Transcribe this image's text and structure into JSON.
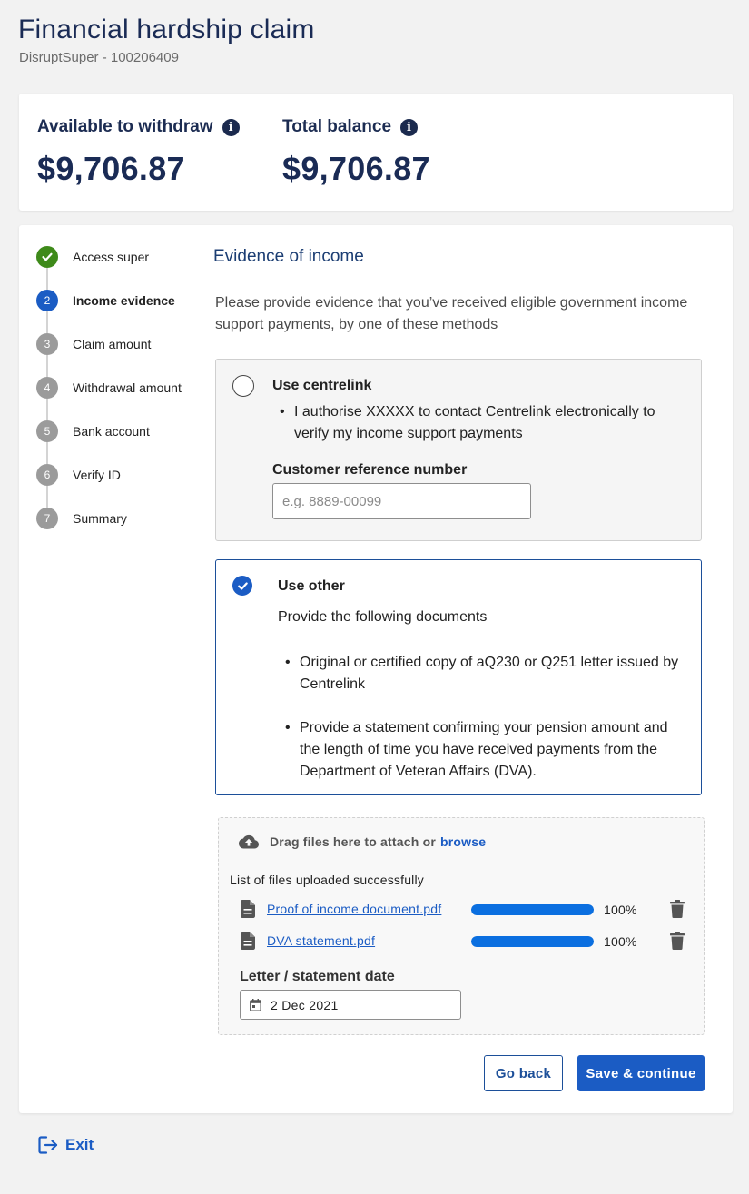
{
  "header": {
    "title": "Financial hardship claim",
    "subtitle": "DisruptSuper - 100206409"
  },
  "balances": {
    "available_label": "Available to withdraw",
    "available_value": "$9,706.87",
    "total_label": "Total balance",
    "total_value": "$9,706.87",
    "info_icon": "i"
  },
  "stepper": {
    "steps": [
      {
        "number": "",
        "label": "Access super",
        "state": "done"
      },
      {
        "number": "2",
        "label": "Income evidence",
        "state": "active"
      },
      {
        "number": "3",
        "label": "Claim amount",
        "state": "pending"
      },
      {
        "number": "4",
        "label": "Withdrawal amount",
        "state": "pending"
      },
      {
        "number": "5",
        "label": "Bank account",
        "state": "pending"
      },
      {
        "number": "6",
        "label": "Verify ID",
        "state": "pending"
      },
      {
        "number": "7",
        "label": "Summary",
        "state": "pending"
      }
    ]
  },
  "content": {
    "section_title": "Evidence of income",
    "intro": "Please provide evidence that you’ve received eligible government income support payments, by one of these methods"
  },
  "option_centrelink": {
    "title": "Use centrelink",
    "bullet": "I authorise XXXXX to contact Centrelink electronically to verify my income support payments",
    "field_label": "Customer reference number",
    "field_placeholder": "e.g. 8889-00099",
    "field_value": "",
    "selected": false
  },
  "option_other": {
    "title": "Use other",
    "description": "Provide the following documents",
    "bullets": [
      "Original or certified copy of  aQ230 or Q251 letter issued by Centrelink",
      "Provide a statement confirming your pension amount and the length of time you have received payments from the Department of Veteran Affairs (DVA)."
    ],
    "selected": true
  },
  "upload": {
    "drop_text": "Drag files here to attach or",
    "browse_label": "browse",
    "success_text": "List of files uploaded successfully",
    "files": [
      {
        "name": "Proof of income document.pdf",
        "progress": 1.0,
        "progress_label": "100%"
      },
      {
        "name": "DVA statement.pdf",
        "progress": 1.0,
        "progress_label": "100%"
      }
    ],
    "date_label": "Letter / statement date",
    "date_value": "2 Dec 2021"
  },
  "actions": {
    "back_label": "Go back",
    "save_label": "Save & continue"
  },
  "footer": {
    "exit_label": "Exit"
  },
  "colors": {
    "primary": "#1b5cc4",
    "navy": "#1a2b55",
    "success": "#3e8a1a",
    "progress": "#0b6fe0",
    "step_pending": "#9b9b9b"
  },
  "icons": {
    "info": "info-icon",
    "check": "check-icon",
    "upload": "cloud-upload-icon",
    "file": "file-icon",
    "trash": "trash-icon",
    "calendar": "calendar-icon",
    "exit": "exit-icon"
  }
}
